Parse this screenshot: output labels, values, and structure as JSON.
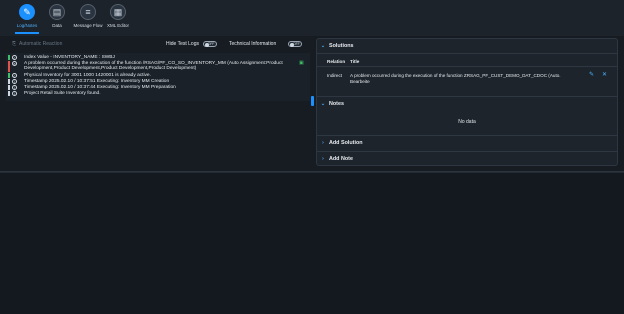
{
  "toolbar": {
    "items": [
      {
        "label": "Log/Notes",
        "icon": "log-notes-icon",
        "glyph": "✎",
        "active": true
      },
      {
        "label": "Data",
        "icon": "data-icon",
        "glyph": "▤",
        "active": false
      },
      {
        "label": "Message Flow",
        "icon": "message-flow-icon",
        "glyph": "≡",
        "active": false
      },
      {
        "label": "XML Editor",
        "icon": "xml-editor-icon",
        "glyph": "▦",
        "active": false
      }
    ]
  },
  "log_pane": {
    "auto_resolve_label": "Automatic Reaction",
    "hide_test_logs_label": "Hide Test Logs",
    "hide_test_logs_state": "OFF",
    "technical_info_label": "Technical Information",
    "technical_info_state": "OFF",
    "rows": [
      {
        "status": "success",
        "text": "Index Value - INVENTORY_NAME : SWBJ"
      },
      {
        "status": "error",
        "text": "A problem occurred during the execution of the function /RSAG/PF_CO_SO_INVENTORY_MM (Auto Assignment:Product Development,Product Development,Product Development,Product Development)"
      },
      {
        "status": "success",
        "text": "Physical Inventory for 3001 1000 1420001 is already active."
      },
      {
        "status": "info",
        "text": "Timestamp 2025.02.10 / 10:37:51 Executing: Inventory MM Creation"
      },
      {
        "status": "info",
        "text": "Timestamp 2025.02.10 / 10:37:44 Executing: Inventory MM Preparation"
      },
      {
        "status": "info",
        "text": "Project Retail Suite Inventory found."
      }
    ]
  },
  "solutions": {
    "title": "Solutions",
    "col_relation": "Relation",
    "col_title": "Title",
    "rows": [
      {
        "relation": "Indirect",
        "title": "A problem occurred during the execution of the function ZRSAG_PF_CUST_DEMO_DAT_CDOC (Auto. Bearbeite"
      }
    ]
  },
  "notes": {
    "title": "Notes",
    "empty_text": "No data"
  },
  "add_solution_label": "Add Solution",
  "add_note_label": "Add Note",
  "colors": {
    "accent": "#1b90ff",
    "success": "#3fbf66",
    "error": "#e0534a",
    "info": "#cfd8e2",
    "background": "#14191f"
  }
}
